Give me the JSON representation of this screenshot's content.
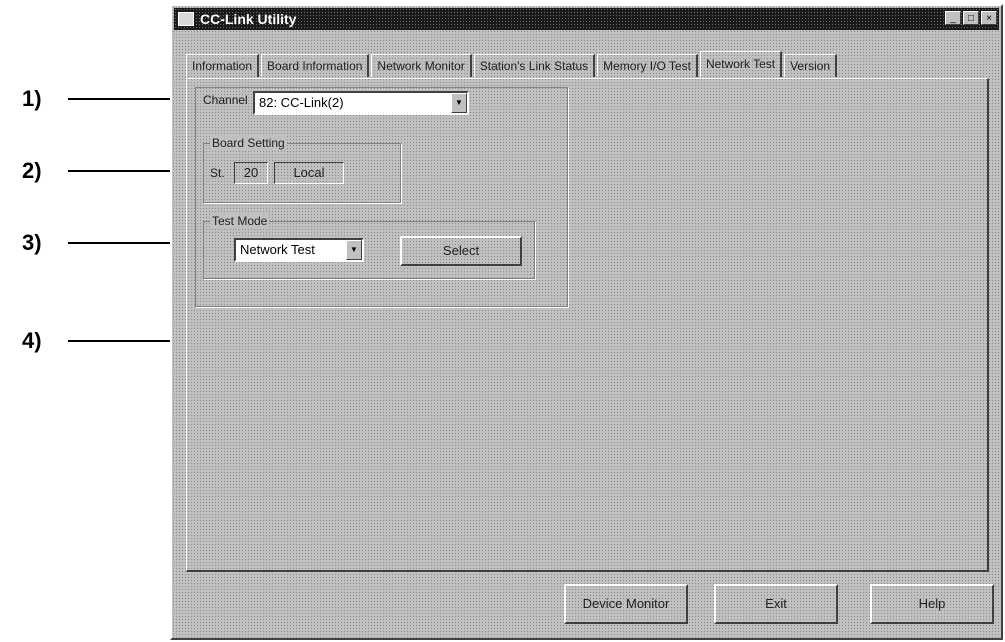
{
  "annotations": [
    "1)",
    "2)",
    "3)",
    "4)"
  ],
  "window": {
    "title": "CC-Link Utility",
    "buttons": [
      "_",
      "□",
      "×"
    ]
  },
  "tabs": [
    {
      "label": "Information",
      "active": false
    },
    {
      "label": "Board Information",
      "active": false
    },
    {
      "label": "Network Monitor",
      "active": false
    },
    {
      "label": "Station's Link Status",
      "active": false
    },
    {
      "label": "Memory I/O Test",
      "active": false
    },
    {
      "label": "Network Test",
      "active": true
    },
    {
      "label": "Version",
      "active": false
    }
  ],
  "channel": {
    "label": "Channel",
    "value": "82: CC-Link(2)"
  },
  "board_setting": {
    "title": "Board Setting",
    "st_label": "St.",
    "st_value": "20",
    "type_value": "Local"
  },
  "test_mode": {
    "title": "Test Mode",
    "value": "Network Test",
    "select_label": "Select"
  },
  "footer": {
    "device_monitor": "Device Monitor",
    "exit": "Exit",
    "help": "Help"
  },
  "icons": {
    "dropdown": "chevron-down-icon",
    "app": "app-icon"
  }
}
